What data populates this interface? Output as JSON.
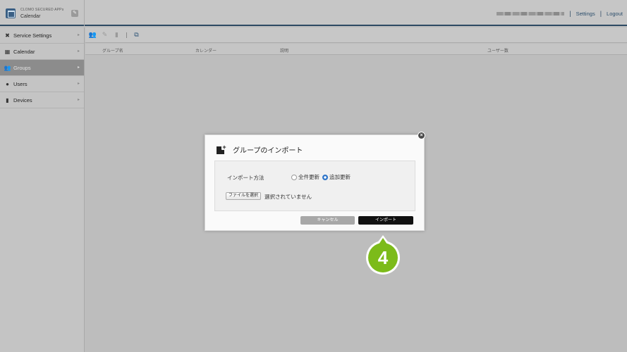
{
  "header": {
    "brand_small": "CLOMO SECURED APPs",
    "app_name": "Calendar",
    "settings_label": "Settings",
    "logout_label": "Logout",
    "separator": "|"
  },
  "sidebar": {
    "items": [
      {
        "label": "Service Settings",
        "icon": "tools-icon",
        "active": false
      },
      {
        "label": "Calendar",
        "icon": "calendar-icon",
        "active": false
      },
      {
        "label": "Groups",
        "icon": "users-icon",
        "active": true
      },
      {
        "label": "Users",
        "icon": "user-icon",
        "active": false
      },
      {
        "label": "Devices",
        "icon": "device-icon",
        "active": false
      }
    ],
    "arrow": "▸"
  },
  "toolbar": {
    "icons": [
      "add-group-icon",
      "edit-icon",
      "delete-icon",
      "import-icon"
    ]
  },
  "table": {
    "columns": [
      "グループ名",
      "カレンダー",
      "説明",
      "ユーザー数"
    ]
  },
  "modal": {
    "title": "グループのインポート",
    "import_method_label": "インポート方法",
    "options": [
      {
        "label": "全件更新",
        "checked": false
      },
      {
        "label": "追加更新",
        "checked": true
      }
    ],
    "file_button": "ファイルを選択",
    "file_status": "選択されていません",
    "cancel_label": "キャンセル",
    "import_label": "インポート",
    "close_glyph": "×"
  },
  "step_marker": {
    "number": "4",
    "color": "#7cbb1a"
  },
  "colors": {
    "accent_bar": "#2d4a63",
    "active_nav": "#8c8c8c",
    "primary_button": "#111111",
    "cancel_button": "#a8a8a8",
    "radio_checked": "#2e75c9"
  }
}
